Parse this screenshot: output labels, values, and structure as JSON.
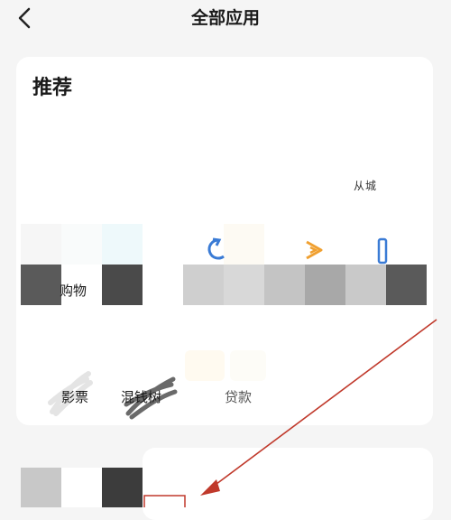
{
  "header": {
    "title": "全部应用"
  },
  "recommend": {
    "title": "推荐",
    "top_right_text": "从城",
    "apps": [
      {
        "label": "购物"
      },
      {
        "label": "影票"
      },
      {
        "label": "混钱树"
      },
      {
        "label": "贷款"
      }
    ]
  },
  "colors": {
    "arrow": "#c0392b",
    "box": "#c0392b",
    "icon_blue": "#3a7bd5",
    "icon_orange": "#f0a030"
  }
}
